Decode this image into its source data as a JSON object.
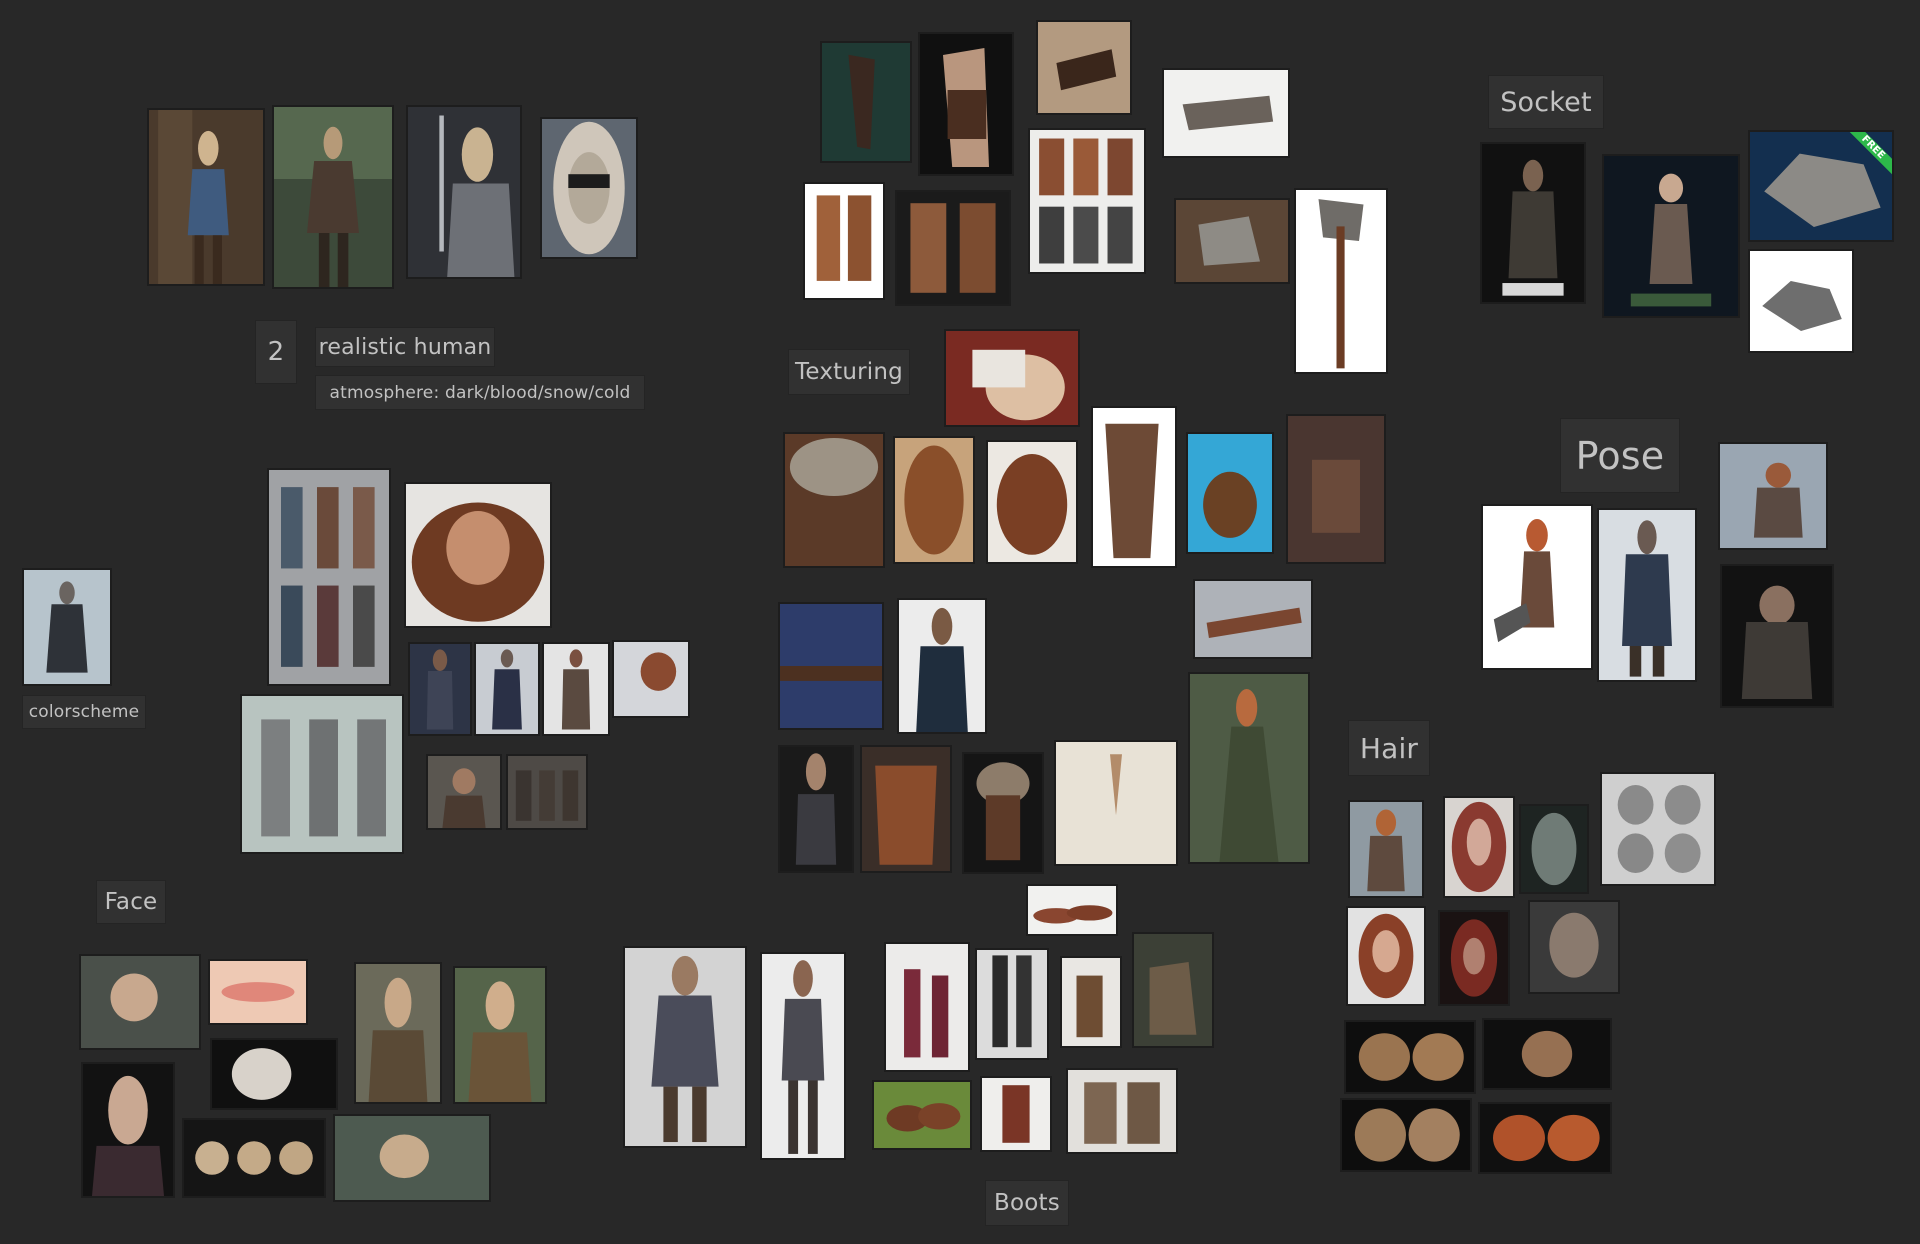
{
  "labels": {
    "count": "2",
    "realistic_human": "realistic human",
    "atmosphere": "atmosphere: dark/blood/snow/cold",
    "texturing": "Texturing",
    "socket": "Socket",
    "pose": "Pose",
    "hair": "Hair",
    "colorscheme": "colorscheme",
    "face": "Face",
    "boots": "Boots"
  },
  "badges": {
    "free": "FREE"
  },
  "colors": {
    "canvas_background": "#282828",
    "label_background": "#313131",
    "label_text": "#c2c2c2",
    "free_badge": "#2db84a"
  }
}
